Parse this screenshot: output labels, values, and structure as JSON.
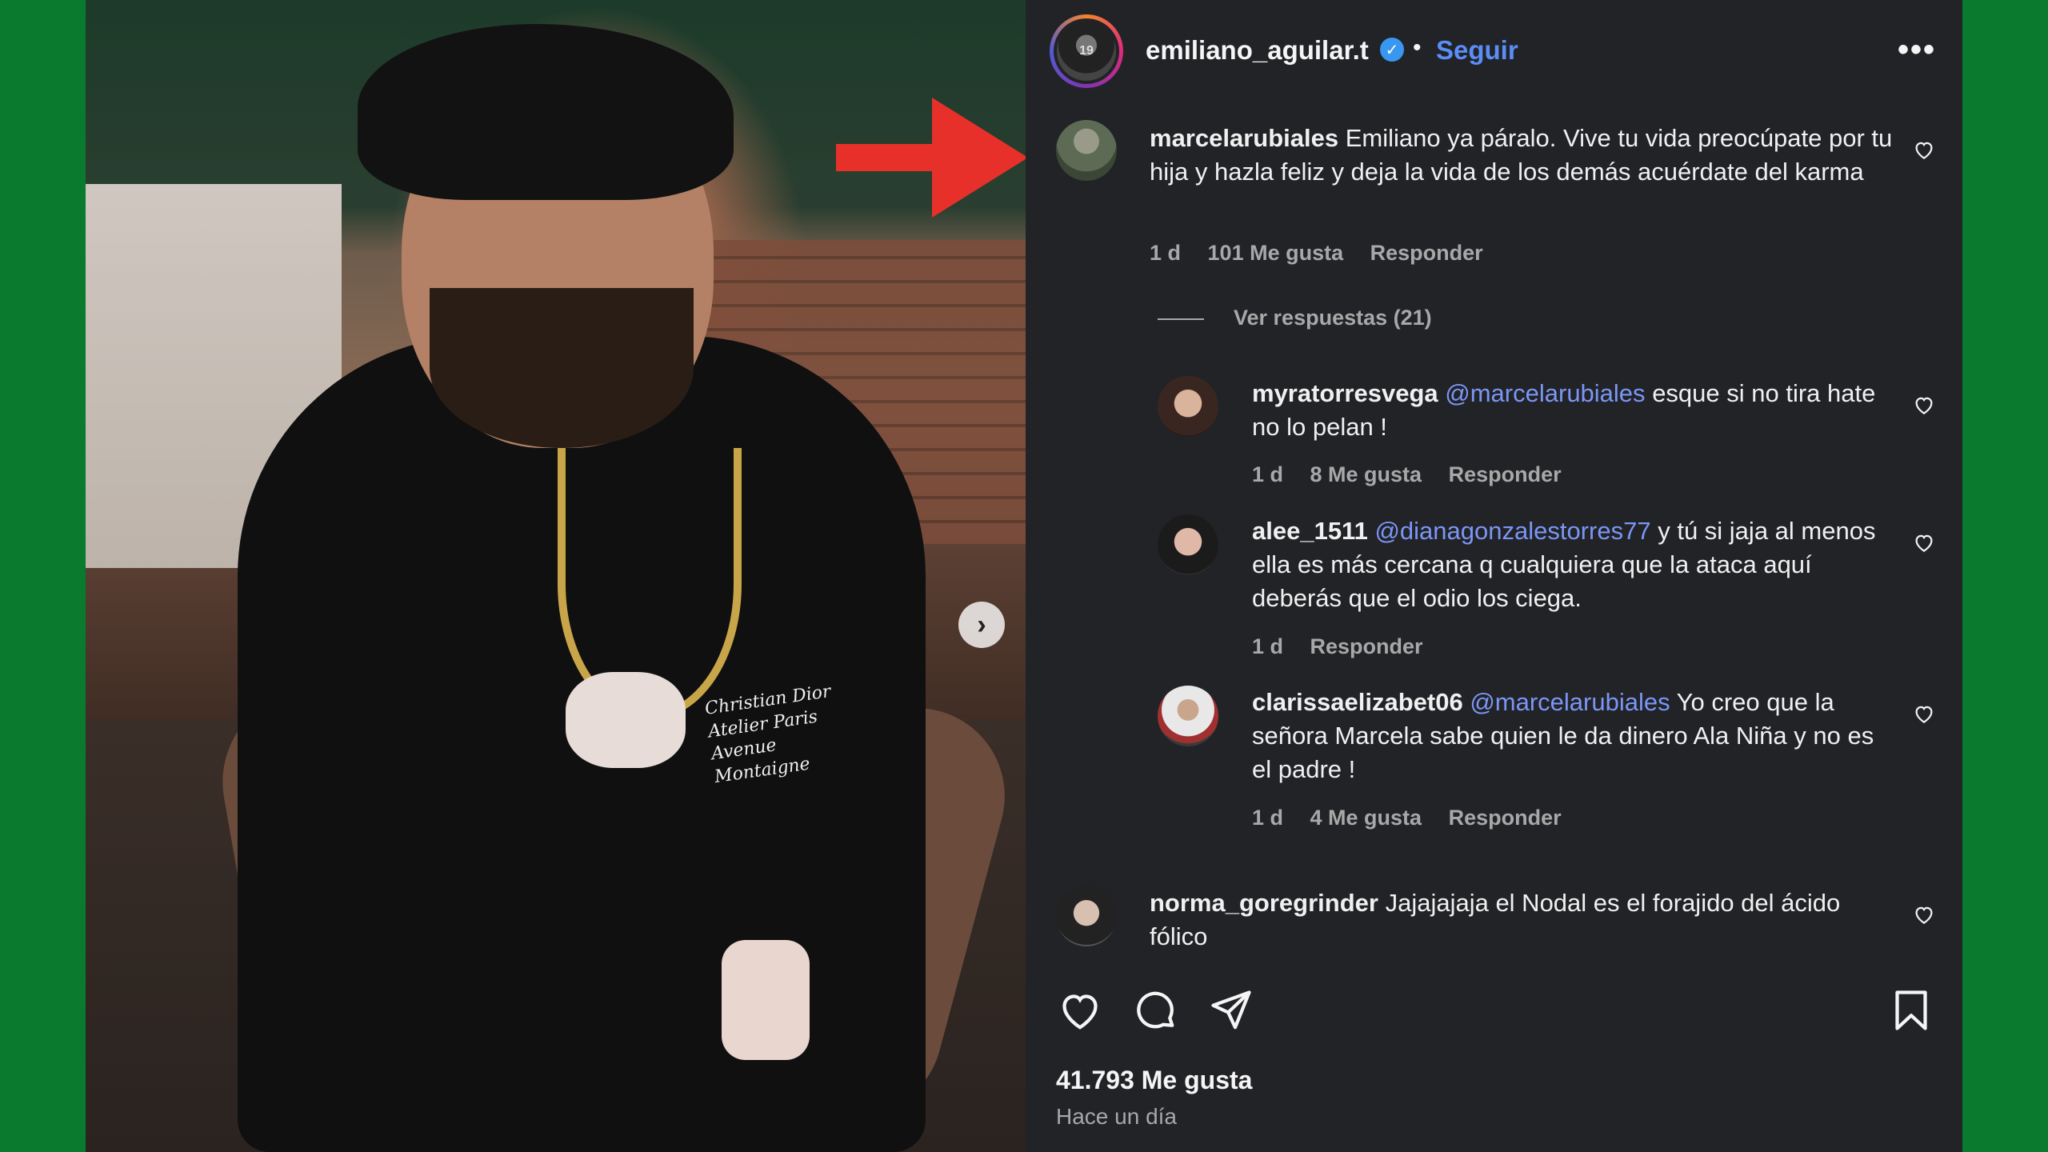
{
  "header": {
    "username": "emiliano_aguilar.t",
    "separator": "•",
    "follow_label": "Seguir",
    "more_label": "•••"
  },
  "photo": {
    "next_label": "›",
    "shirt_print": "Christian Dior Atelier Paris Avenue Montaigne"
  },
  "comments": [
    {
      "user": "marcelarubiales",
      "text": "Emiliano ya páralo. Vive tu vida preocúpate por tu hija y hazla feliz y deja la vida de los demás acuérdate del karma",
      "time": "1 d",
      "likes": "101 Me gusta",
      "reply": "Responder",
      "view_replies": "Ver respuestas (21)"
    },
    {
      "user": "myratorresvega",
      "mention": "@marcelarubiales",
      "text": "esque si no tira hate no lo pelan !",
      "time": "1 d",
      "likes": "8 Me gusta",
      "reply": "Responder"
    },
    {
      "user": "alee_1511",
      "mention": "@dianagonzalestorres77",
      "text": "y tú si jaja al menos ella es más cercana q cualquiera que la ataca aquí deberás que el odio los ciega.",
      "time": "1 d",
      "reply": "Responder"
    },
    {
      "user": "clarissaelizabet06",
      "mention": "@marcelarubiales",
      "text": "Yo creo que la señora Marcela sabe quien le da dinero Ala Niña y no es el padre !",
      "time": "1 d",
      "likes": "4 Me gusta",
      "reply": "Responder"
    },
    {
      "user": "norma_goregrinder",
      "text": "Jajajajaja el Nodal es el forajido del ácido fólico"
    }
  ],
  "footer": {
    "likes": "41.793 Me gusta",
    "time": "Hace un día"
  },
  "colors": {
    "page_bg": "#0a7a2e",
    "panel_bg": "#222327",
    "mention": "#7b96f5",
    "follow": "#5b8df7",
    "verified": "#3897f0",
    "arrow": "#e8302b"
  },
  "icons": [
    "chevron-right-icon",
    "verified-icon",
    "more-icon",
    "heart-icon",
    "comment-icon",
    "share-icon",
    "bookmark-icon",
    "red-arrow-icon"
  ]
}
